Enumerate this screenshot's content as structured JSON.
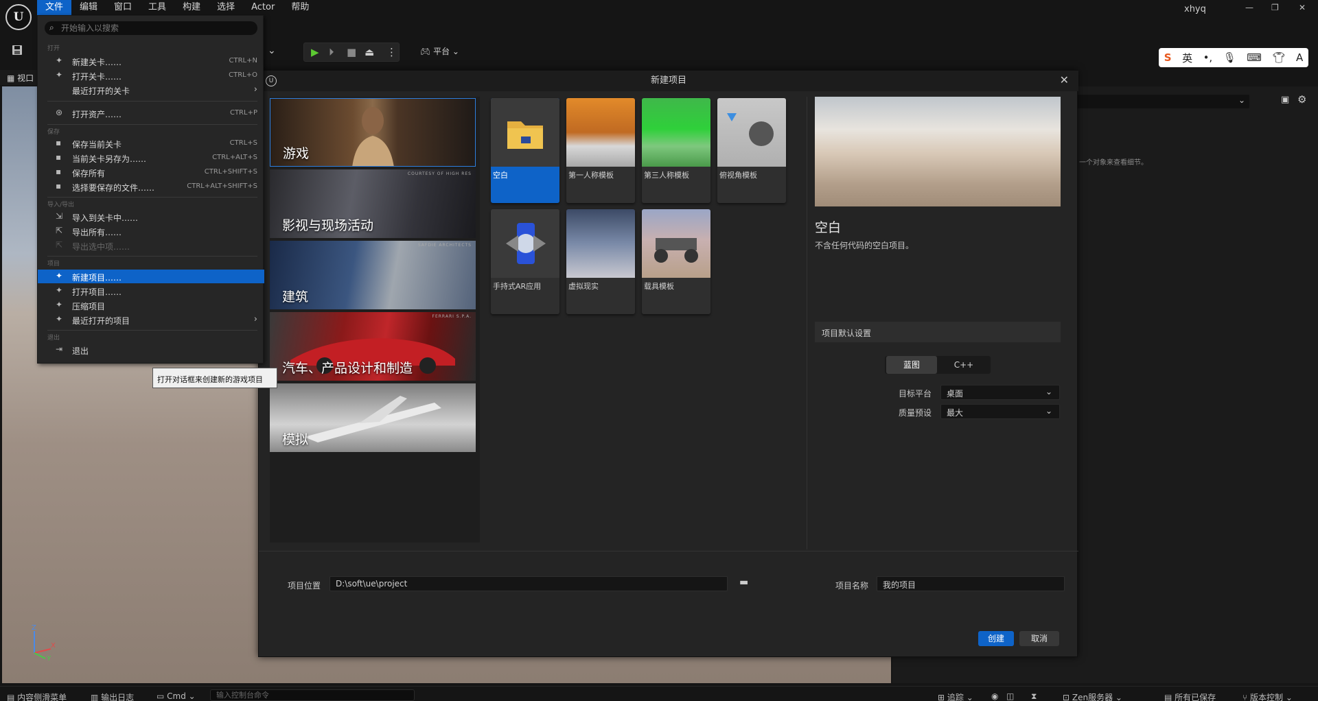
{
  "app": {
    "logo_text": "U",
    "username": "xhyq"
  },
  "menubar": [
    {
      "label": "文件"
    },
    {
      "label": "编辑"
    },
    {
      "label": "窗口"
    },
    {
      "label": "工具"
    },
    {
      "label": "构建"
    },
    {
      "label": "选择"
    },
    {
      "label": "Actor"
    },
    {
      "label": "帮助"
    }
  ],
  "window_controls": {
    "minimize": "—",
    "restore": "❐",
    "close": "✕"
  },
  "toolbar": {
    "platform_label": "平台"
  },
  "ime": {
    "mode_label": "英"
  },
  "viewport": {
    "tab_label": "视口",
    "axis_z": "Z",
    "axis_x": "X",
    "axis_y": "Y"
  },
  "details": {
    "hint": "一个对象来查看细节。"
  },
  "file_menu": {
    "search_placeholder": "开始输入以搜索",
    "sections": {
      "open": "打开",
      "save": "保存",
      "import_export": "导入/导出",
      "project": "项目",
      "exit": "退出"
    },
    "items": [
      {
        "label": "新建关卡……",
        "shortcut": "CTRL+N"
      },
      {
        "label": "打开关卡……",
        "shortcut": "CTRL+O"
      },
      {
        "label": "最近打开的关卡",
        "shortcut": ""
      },
      {
        "label": "打开资产……",
        "shortcut": "CTRL+P"
      },
      {
        "label": "保存当前关卡",
        "shortcut": "CTRL+S"
      },
      {
        "label": "当前关卡另存为……",
        "shortcut": "CTRL+ALT+S"
      },
      {
        "label": "保存所有",
        "shortcut": "CTRL+SHIFT+S"
      },
      {
        "label": "选择要保存的文件……",
        "shortcut": "CTRL+ALT+SHIFT+S"
      },
      {
        "label": "导入到关卡中……",
        "shortcut": ""
      },
      {
        "label": "导出所有……",
        "shortcut": ""
      },
      {
        "label": "导出选中项……",
        "shortcut": ""
      },
      {
        "label": "新建项目……",
        "shortcut": ""
      },
      {
        "label": "打开项目……",
        "shortcut": ""
      },
      {
        "label": "压缩项目",
        "shortcut": ""
      },
      {
        "label": "最近打开的项目",
        "shortcut": ""
      },
      {
        "label": "退出",
        "shortcut": ""
      }
    ]
  },
  "tooltip": "打开对话框来创建新的游戏项目",
  "dialog": {
    "title": "新建项目",
    "categories": [
      {
        "label": "游戏",
        "credit": ""
      },
      {
        "label": "影视与现场活动",
        "credit": "COURTESY OF HIGH RES"
      },
      {
        "label": "建筑",
        "credit": "SAFDIE ARCHITECTS"
      },
      {
        "label": "汽车、产品设计和制造",
        "credit": "FERRARI S.P.A."
      },
      {
        "label": "模拟",
        "credit": ""
      }
    ],
    "templates": [
      {
        "label": "空白"
      },
      {
        "label": "第一人称模板"
      },
      {
        "label": "第三人称模板"
      },
      {
        "label": "俯视角模板"
      },
      {
        "label": "手持式AR应用"
      },
      {
        "label": "虚拟现实"
      },
      {
        "label": "载具模板"
      }
    ],
    "preview": {
      "title": "空白",
      "description": "不含任何代码的空白项目。"
    },
    "settings": {
      "header": "项目默认设置",
      "toggle": [
        "蓝图",
        "C++"
      ],
      "target_platform_label": "目标平台",
      "target_platform_value": "桌面",
      "quality_label": "质量预设",
      "quality_value": "最大"
    },
    "location_label": "项目位置",
    "location_value": "D:\\soft\\ue\\project",
    "name_label": "项目名称",
    "name_value": "我的项目",
    "create_label": "创建",
    "cancel_label": "取消"
  },
  "bottombar": {
    "content_drawer": "内容侧滑菜单",
    "output_log": "输出日志",
    "cmd": "Cmd",
    "console_placeholder": "输入控制台命令",
    "trace": "追踪",
    "zen": "Zen服务器",
    "all_saved": "所有已保存",
    "version_control": "版本控制"
  }
}
